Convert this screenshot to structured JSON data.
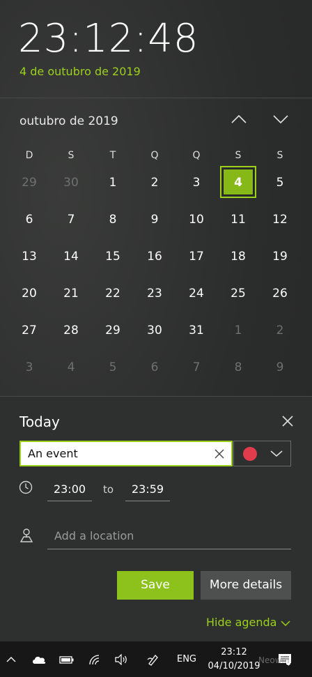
{
  "clock": {
    "time": "23:12:48",
    "date": "4 de outubro de 2019"
  },
  "calendar": {
    "month_label": "outubro de 2019",
    "weekdays": [
      "D",
      "S",
      "T",
      "Q",
      "Q",
      "S",
      "S"
    ],
    "weeks": [
      [
        "29",
        "30",
        "1",
        "2",
        "3",
        "4",
        "5"
      ],
      [
        "6",
        "7",
        "8",
        "9",
        "10",
        "11",
        "12"
      ],
      [
        "13",
        "14",
        "15",
        "16",
        "17",
        "18",
        "19"
      ],
      [
        "20",
        "21",
        "22",
        "23",
        "24",
        "25",
        "26"
      ],
      [
        "27",
        "28",
        "29",
        "30",
        "31",
        "1",
        "2"
      ],
      [
        "3",
        "4",
        "5",
        "6",
        "7",
        "8",
        "9"
      ]
    ],
    "today": "4"
  },
  "agenda": {
    "title": "Today",
    "event_value": "An event",
    "event_color": "#e03c4c",
    "start_time": "23:00",
    "to_label": "to",
    "end_time": "23:59",
    "location_placeholder": "Add a location",
    "save_label": "Save",
    "more_details_label": "More details",
    "hide_agenda_label": "Hide agenda"
  },
  "taskbar": {
    "language": "ENG",
    "time": "23:12",
    "date": "04/10/2019",
    "notification_count": "6"
  },
  "watermark": "Neowin",
  "colors": {
    "accent": "#9bd11d",
    "save": "#8dc21d"
  }
}
